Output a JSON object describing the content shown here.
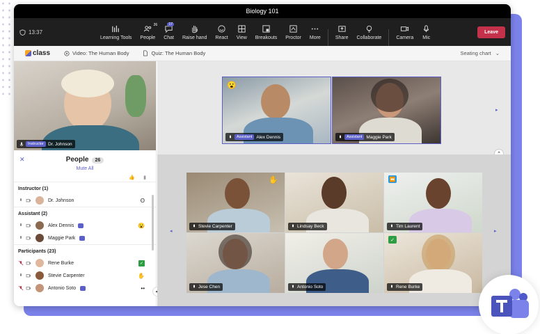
{
  "window": {
    "title": "Biology 101"
  },
  "toolbar": {
    "timer": "13:37",
    "people_count": "26",
    "chat_count": "17",
    "items": [
      {
        "label": "Learning Tools",
        "icon": "bars-icon"
      },
      {
        "label": "People",
        "icon": "people-icon"
      },
      {
        "label": "Chat",
        "icon": "chat-icon"
      },
      {
        "label": "Raise hand",
        "icon": "hand-icon"
      },
      {
        "label": "React",
        "icon": "smile-icon"
      },
      {
        "label": "View",
        "icon": "grid-icon"
      },
      {
        "label": "Breakouts",
        "icon": "breakout-icon"
      },
      {
        "label": "Proctor",
        "icon": "proctor-icon"
      },
      {
        "label": "More",
        "icon": "more-icon"
      }
    ],
    "items2": [
      {
        "label": "Share",
        "icon": "share-icon"
      },
      {
        "label": "Collaborate",
        "icon": "bulb-icon"
      }
    ],
    "items3": [
      {
        "label": "Camera",
        "icon": "camera-icon"
      },
      {
        "label": "Mic",
        "icon": "mic-icon"
      }
    ],
    "leave_label": "Leave"
  },
  "tabs": {
    "logo_text": "class",
    "tab1": "Video: The Human Body",
    "tab2": "Quiz: The Human Body",
    "seating": "Seating chart"
  },
  "instructor_video": {
    "role": "Instructor",
    "name": "Dr. Johnson"
  },
  "people_panel": {
    "title": "People",
    "count": "26",
    "mute_all": "Mute All",
    "sections": {
      "instructor": "Instructor (1)",
      "assistant": "Assistant (2)",
      "participants": "Participants (23)"
    },
    "instructors": [
      {
        "name": "Dr. Johnson"
      }
    ],
    "assistants": [
      {
        "name": "Alex Dennis"
      },
      {
        "name": "Maggie Park"
      }
    ],
    "participants": [
      {
        "name": "Rene Burke"
      },
      {
        "name": "Stevie Carpenter"
      },
      {
        "name": "Antonio Soto"
      }
    ]
  },
  "top_tiles": [
    {
      "role": "Assistant",
      "name": "Alex Dennis"
    },
    {
      "role": "Assistant",
      "name": "Maggie Park"
    }
  ],
  "grid_tiles": [
    {
      "name": "Stevie Carpenter"
    },
    {
      "name": "Lindsay Beck"
    },
    {
      "name": "Tim Laurent"
    },
    {
      "name": "Jese Chen"
    },
    {
      "name": "Antonio Soto"
    },
    {
      "name": "Rene Burke"
    }
  ],
  "colors": {
    "accent": "#5b5fc7",
    "leave": "#c4314b",
    "brand_bg": "#7b83eb"
  }
}
